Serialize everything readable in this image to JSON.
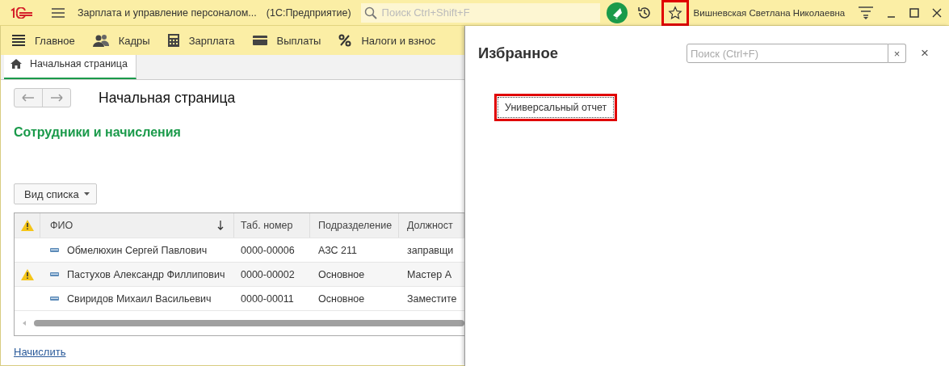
{
  "title_bar": {
    "app_title": "Зарплата и управление персоналом...",
    "platform": "(1С:Предприятие)",
    "search": {
      "placeholder": "Поиск Ctrl+Shift+F"
    },
    "favorites_highlighted": true,
    "user": "Вишневская Светлана Николаевна"
  },
  "sections": [
    {
      "kind": "menu",
      "label": "Главное"
    },
    {
      "kind": "people",
      "label": "Кадры"
    },
    {
      "kind": "calculator",
      "label": "Зарплата"
    },
    {
      "kind": "card",
      "label": "Выплаты"
    },
    {
      "kind": "percent",
      "label": "Налоги и взнос"
    }
  ],
  "tabs": [
    {
      "label": "Начальная страница",
      "selected": true
    }
  ],
  "page": {
    "title": "Начальная страница",
    "section_title": "Сотрудники и начисления",
    "view_button": "Вид списка",
    "table": {
      "columns": [
        "ФИО",
        "Таб. номер",
        "Подразделение",
        "Должност"
      ],
      "rows": [
        {
          "warning": false,
          "cells": [
            "Обмелюхин Сергей Павлович",
            "0000-00006",
            "АЗС 211",
            "заправщи"
          ]
        },
        {
          "warning": true,
          "cells": [
            "Пастухов Александр Филлипович",
            "0000-00002",
            "Основное",
            "Мастер А"
          ]
        },
        {
          "warning": false,
          "cells": [
            "Свиридов Михаил Васильевич",
            "0000-00011",
            "Основное",
            "Заместите"
          ]
        }
      ]
    },
    "link": "Начислить"
  },
  "favorites": {
    "title": "Избранное",
    "search": {
      "placeholder": "Поиск (Ctrl+F)"
    },
    "clear": "×",
    "close": "×",
    "items": [
      {
        "label": "Универсальный отчет",
        "highlighted": true
      }
    ]
  }
}
